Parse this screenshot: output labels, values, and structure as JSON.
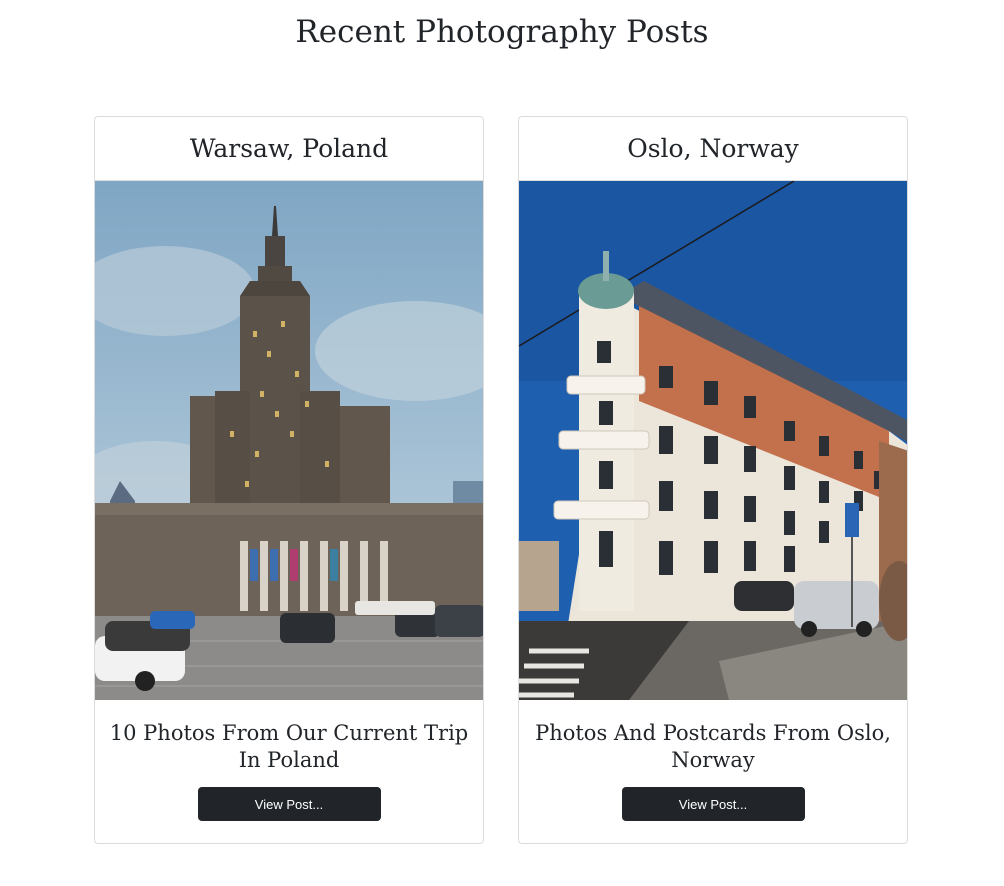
{
  "page": {
    "title": "Recent Photography Posts"
  },
  "cards": [
    {
      "location": "Warsaw, Poland",
      "post_title": "10 Photos From Our Current Trip In Poland",
      "button_label": "View Post..."
    },
    {
      "location": "Oslo, Norway",
      "post_title": "Photos And Postcards From Oslo, Norway",
      "button_label": "View Post..."
    }
  ]
}
